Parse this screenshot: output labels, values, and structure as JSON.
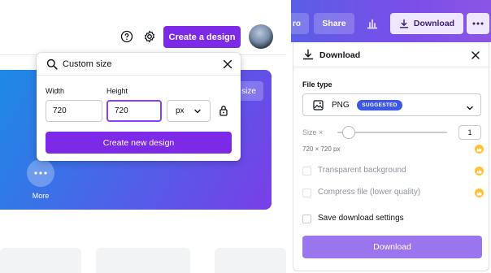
{
  "header": {
    "create_design_label": "Create a design"
  },
  "hero": {
    "pill_text": "size",
    "more_label": "More"
  },
  "custom_size_popup": {
    "search_value": "Custom size",
    "width_label": "Width",
    "height_label": "Height",
    "width_value": "720",
    "height_value": "720",
    "unit_value": "px",
    "create_button_label": "Create new design"
  },
  "editor_topbar": {
    "pro_label": "ro",
    "share_label": "Share",
    "download_label": "Download"
  },
  "download_panel": {
    "title": "Download",
    "file_type_label": "File type",
    "file_type_value": "PNG",
    "suggested_badge": "SUGGESTED",
    "size_label": "Size ×",
    "size_value": "1",
    "dimensions_text": "720 × 720 px",
    "transparent_label": "Transparent background",
    "compress_label": "Compress file (lower quality)",
    "save_settings_label": "Save download settings",
    "download_button_label": "Download",
    "slider_fraction": 0.1
  },
  "colors": {
    "brand_purple": "#7d2ae8",
    "download_button": "#9b75ee",
    "badge_blue": "#3a57e8",
    "crown_gold": "#ffc234"
  },
  "icons": [
    "help-icon",
    "settings-icon",
    "search-icon",
    "close-icon",
    "lock-icon",
    "chevron-down-icon",
    "insights-icon",
    "download-icon",
    "more-icon",
    "image-icon",
    "crown-icon"
  ]
}
